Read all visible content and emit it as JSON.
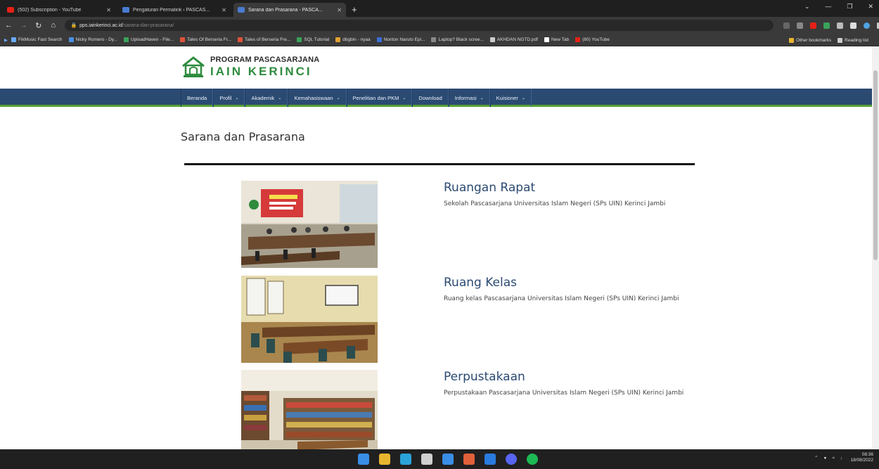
{
  "browser": {
    "tabs": [
      {
        "title": "(502) Subscription - YouTube",
        "fav": "#e62117",
        "active": false
      },
      {
        "title": "Pengaturan Permalink ‹ PASCAS...",
        "fav": "#4a7bd1",
        "active": false
      },
      {
        "title": "Sarana dan Prasarana - PASCA...",
        "fav": "#4a7bd1",
        "active": true
      }
    ],
    "new_tab": "+",
    "url_host": "pps.iainkerinci.ac.id",
    "url_path": "/sarana-dan-prasarana/",
    "bookmarks": [
      {
        "label": "FikMusic Fast Search",
        "color": "#6aa9ff"
      },
      {
        "label": "Nicky Romero - Dy...",
        "color": "#4a90e2"
      },
      {
        "label": "UploadHaven - File...",
        "color": "#3aa35a"
      },
      {
        "label": "Tales Of Berseria Fr...",
        "color": "#e0523a"
      },
      {
        "label": "Tales of Berseria Fre...",
        "color": "#e0523a"
      },
      {
        "label": "SQL Tutorial",
        "color": "#3aa35a"
      },
      {
        "label": "dbgbin - nyaa",
        "color": "#e0a030"
      },
      {
        "label": "Nonton Naruto Epi...",
        "color": "#3a6fd8"
      },
      {
        "label": "Laptop? Black scree...",
        "color": "#888888"
      },
      {
        "label": "AKHDAN NGTD.pdf",
        "color": "#cccccc"
      },
      {
        "label": "New Tab",
        "color": "#ffffff"
      },
      {
        "label": "(80) YouTube",
        "color": "#e62117"
      }
    ],
    "bookmarks_right": [
      {
        "label": "Other bookmarks",
        "color": "#e8b530"
      },
      {
        "label": "Reading list",
        "color": "#cccccc"
      }
    ]
  },
  "site": {
    "logo_line1": "PROGRAM PASCASARJANA",
    "logo_line2": "IAIN KERINCI",
    "nav": [
      {
        "label": "Beranda",
        "dropdown": false
      },
      {
        "label": "Profil",
        "dropdown": true
      },
      {
        "label": "Akademik",
        "dropdown": true
      },
      {
        "label": "Kemahasiswaan",
        "dropdown": true
      },
      {
        "label": "Penelitian dan PKM",
        "dropdown": true
      },
      {
        "label": "Download",
        "dropdown": false
      },
      {
        "label": "Informasi",
        "dropdown": true
      },
      {
        "label": "Kuisioner",
        "dropdown": true
      }
    ],
    "page_title": "Sarana dan Prasarana",
    "facilities": [
      {
        "name": "Ruangan Rapat",
        "desc": "Sekolah Pascasarjana Universitas Islam Negeri (SPs UIN) Kerinci Jambi",
        "photo": "meeting-room"
      },
      {
        "name": "Ruang Kelas",
        "desc": "Ruang kelas Pascasarjana Universitas Islam Negeri (SPs UIN) Kerinci Jambi",
        "photo": "classroom"
      },
      {
        "name": "Perpustakaan",
        "desc": "Perpustakaan Pascasarjana Universitas Islam Negeri (SPs UIN) Kerinci Jambi",
        "photo": "library"
      }
    ]
  },
  "taskbar": {
    "time": "08:36",
    "date": "18/08/2022",
    "pinned": [
      "#3a8ee6",
      "#e8b530",
      "#2aa3d8",
      "#cfcfcf",
      "#3a8ee6",
      "#e0603a",
      "#2a7be0",
      "#5865f2",
      "#1db954"
    ]
  },
  "colors": {
    "nav_bg": "#2b4a72",
    "nav_accent": "#5aa035",
    "brand_green": "#2e8b3e"
  }
}
